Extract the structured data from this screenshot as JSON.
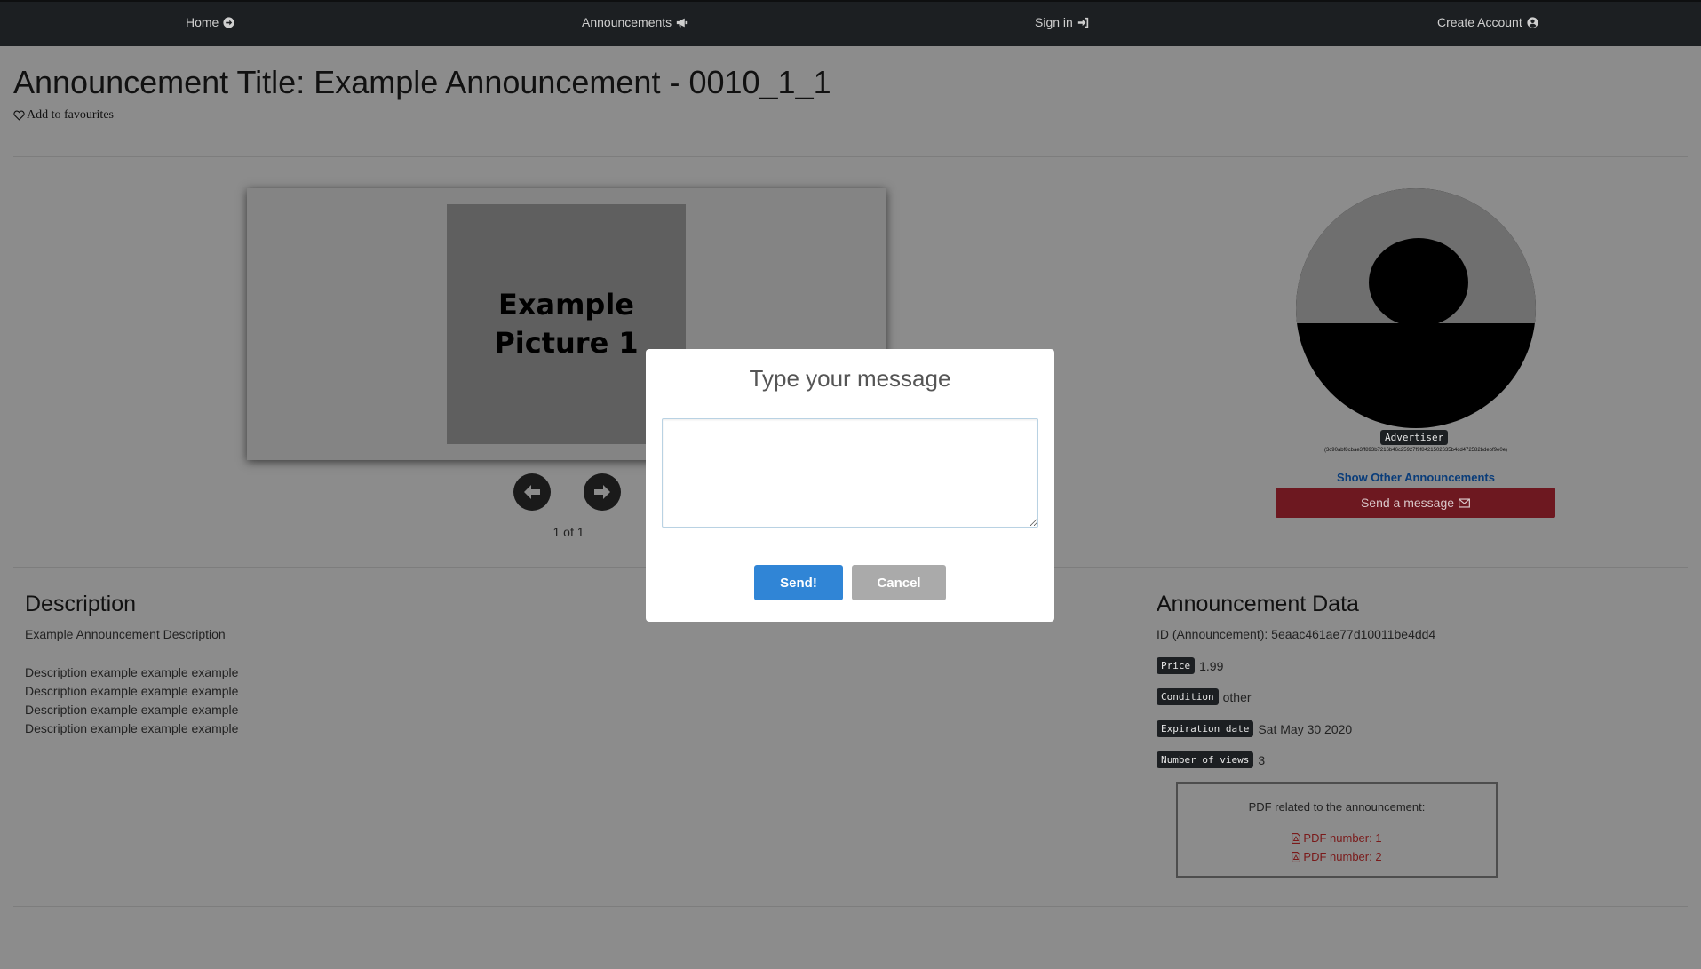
{
  "nav": {
    "home": "Home",
    "announcements": "Announcements",
    "sign_in": "Sign in",
    "create_account": "Create Account"
  },
  "announcement": {
    "title": "Announcement Title: Example Announcement - 0010_1_1",
    "add_favourites": "Add to favourites"
  },
  "carousel": {
    "picture_label": "Example\nPicture 1",
    "counter": "1 of 1"
  },
  "advertiser": {
    "badge": "Advertiser",
    "id": "(3c90abf8cbae3ff893b7216b46c25927f9f8421502635b4cd472582bdebf9e0e)",
    "show_other": "Show Other Announcements",
    "send_message": "Send a message"
  },
  "description": {
    "heading": "Description",
    "summary": "Example Announcement Description",
    "lines": [
      "Description example example example",
      "Description example example example",
      "Description example example example",
      "Description example example example"
    ]
  },
  "data": {
    "heading": "Announcement Data",
    "id_line": "ID (Announcement): 5eaac461ae77d10011be4dd4",
    "price_label": "Price",
    "price_value": "1.99",
    "condition_label": "Condition",
    "condition_value": "other",
    "expiration_label": "Expiration date",
    "expiration_value": "Sat May 30 2020",
    "views_label": "Number of views",
    "views_value": "3",
    "pdf_title": "PDF related to the announcement:",
    "pdf_links": [
      "PDF number: 1",
      "PDF number: 2"
    ]
  },
  "modal": {
    "title": "Type your message",
    "textarea_value": "",
    "send": "Send!",
    "cancel": "Cancel"
  },
  "colors": {
    "navbar": "#1c1f22",
    "send_button": "#3085d6",
    "cancel_button": "#aaaaaa",
    "message_button": "#6d1820",
    "pdf_link": "#7a1a1a"
  },
  "icons": {
    "home": "arrow-circle-right-icon",
    "announcements": "bullhorn-icon",
    "sign_in": "sign-in-icon",
    "create_account": "user-circle-icon",
    "favourite": "heart-outline-icon",
    "prev": "arrow-left-icon",
    "next": "arrow-right-icon",
    "message": "envelope-icon",
    "pdf": "file-pdf-icon"
  }
}
